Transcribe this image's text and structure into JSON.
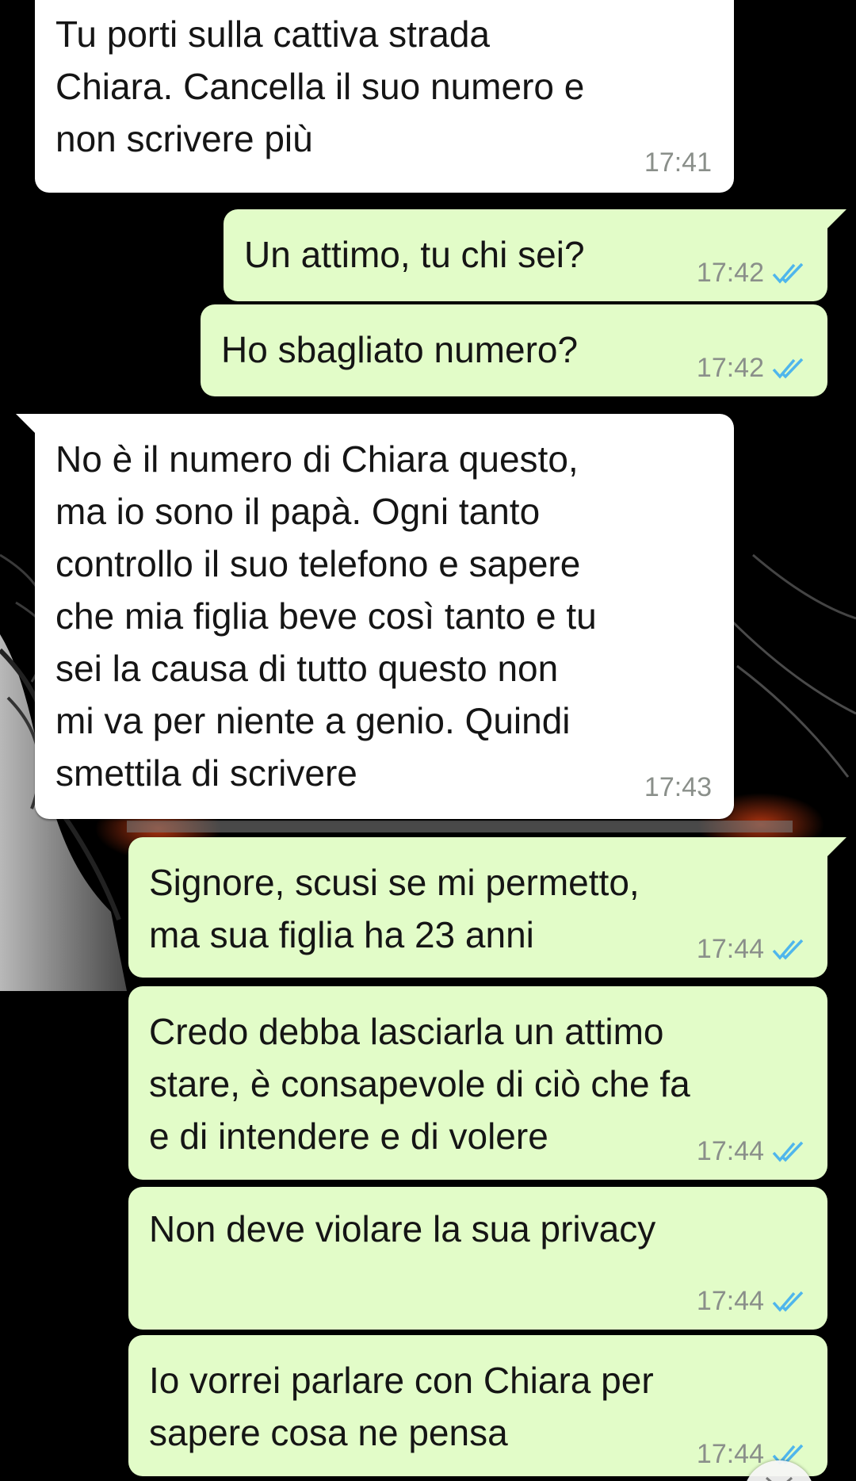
{
  "messages": [
    {
      "direction": "in",
      "text": "Tu porti sulla cattiva strada\nChiara. Cancella il suo numero e\nnon scrivere più",
      "time": "17:41"
    },
    {
      "direction": "out",
      "text": "Un attimo, tu chi sei?",
      "time": "17:42",
      "status": "read"
    },
    {
      "direction": "out",
      "text": "Ho sbagliato numero?",
      "time": "17:42",
      "status": "read"
    },
    {
      "direction": "in",
      "text": "No è il numero di Chiara questo,\nma io sono il papà. Ogni tanto\ncontrollo il suo telefono e sapere\nche mia figlia beve così tanto e tu\nsei la causa di tutto questo non\nmi va per niente a genio. Quindi\nsmettila di scrivere",
      "time": "17:43"
    },
    {
      "direction": "out",
      "text": "Signore, scusi se mi permetto,\nma sua figlia ha 23 anni",
      "time": "17:44",
      "status": "read"
    },
    {
      "direction": "out",
      "text": "Credo debba lasciarla un attimo\nstare, è consapevole di ciò che fa\ne di intendere e di volere",
      "time": "17:44",
      "status": "read"
    },
    {
      "direction": "out",
      "text": "Non deve violare la sua privacy",
      "time": "17:44",
      "status": "read"
    },
    {
      "direction": "out",
      "text": "Io vorrei parlare con Chiara per\nsapere cosa ne pensa",
      "time": "17:44",
      "status": "read"
    }
  ],
  "colors": {
    "incoming_bubble": "#ffffff",
    "outgoing_bubble": "#e2fcc8",
    "read_tick": "#4fb6ec",
    "timestamp": "#8a8f8a",
    "background": "#000000"
  },
  "icons": {
    "read_status": "double-check-icon",
    "scroll_down": "chevron-down-icon"
  }
}
